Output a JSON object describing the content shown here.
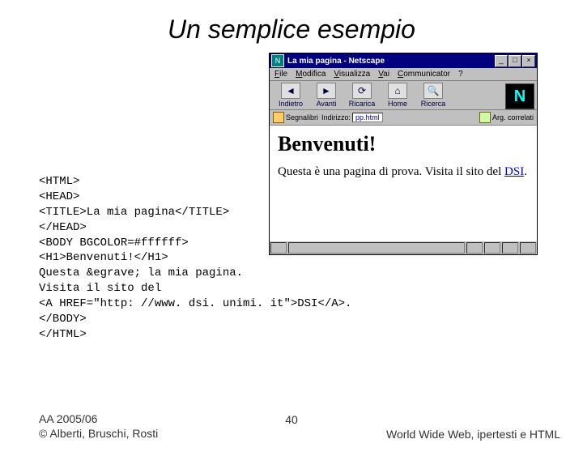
{
  "slide": {
    "title": "Un semplice esempio",
    "page_number": "40",
    "footer_left_line1": "AA 2005/06",
    "footer_left_line2": "© Alberti, Bruschi, Rosti",
    "footer_right": "World Wide Web, ipertesti e HTML"
  },
  "code": "<HTML>\n<HEAD>\n<TITLE>La mia pagina</TITLE>\n</HEAD>\n<BODY BGCOLOR=#ffffff>\n<H1>Benvenuti!</H1>\nQuesta &egrave; la mia pagina.\nVisita il sito del\n<A HREF=\"http: //www. dsi. unimi. it\">DSI</A>.\n</BODY>\n</HTML>",
  "browser": {
    "window_title": "La mia pagina - Netscape",
    "menu": [
      "File",
      "Modifica",
      "Visualizza",
      "Vai",
      "Communicator",
      "?"
    ],
    "toolbar": {
      "back": "Indietro",
      "forward": "Avanti",
      "reload": "Ricarica",
      "home": "Home",
      "search": "Ricerca"
    },
    "locbar": {
      "bookmarks": "Segnalibri",
      "address_label": "Indirizzo:",
      "address_value": "pp.html",
      "related": "Arg. correlati"
    },
    "page": {
      "heading": "Benvenuti!",
      "para_pre": "Questa è una pagina di prova. Visita il sito del ",
      "link": "DSI",
      "para_post": "."
    }
  }
}
